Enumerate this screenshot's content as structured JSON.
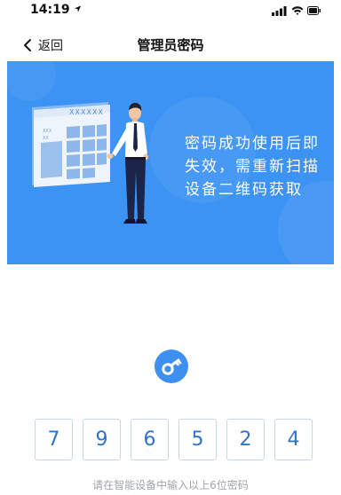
{
  "status_bar": {
    "time": "14:19"
  },
  "nav": {
    "back_label": "返回",
    "title": "管理员密码"
  },
  "banner": {
    "board_text": "XXXXXX",
    "board_label_1": "XXX",
    "board_label_2": "XX",
    "message_lines": [
      "密码成功使用后即",
      "失效，需重新扫描",
      "设备二维码获取"
    ]
  },
  "password": {
    "digits": [
      "7",
      "9",
      "6",
      "5",
      "2",
      "4"
    ]
  },
  "hint": "请在智能设备中输入以上6位密码",
  "colors": {
    "accent": "#3d93f3",
    "digit_text": "#2f73c8",
    "digit_border": "#c9d6e8",
    "hint_text": "#a0a4aa"
  },
  "icons": {
    "back": "chevron-left-icon",
    "key": "key-icon",
    "signal": "signal-icon",
    "wifi": "wifi-icon",
    "battery": "battery-icon",
    "location": "location-arrow-icon"
  }
}
